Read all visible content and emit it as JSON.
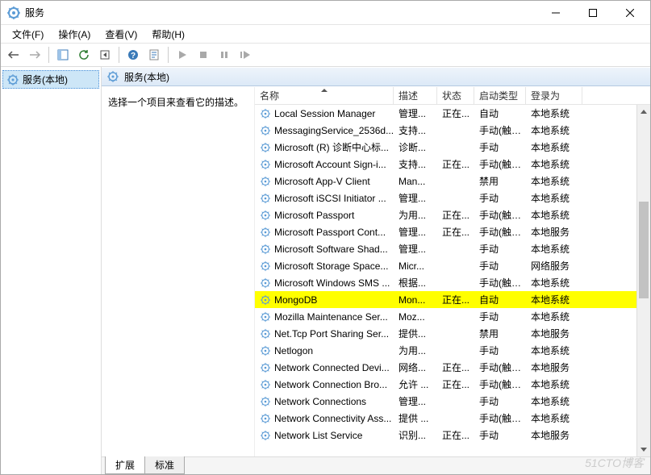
{
  "window": {
    "title": "服务"
  },
  "menu": {
    "file": "文件(F)",
    "action": "操作(A)",
    "view": "查看(V)",
    "help": "帮助(H)"
  },
  "tree": {
    "root": "服务(本地)"
  },
  "pane": {
    "header": "服务(本地)",
    "detail_prompt": "选择一个项目来查看它的描述。"
  },
  "columns": {
    "name": "名称",
    "description": "描述",
    "status": "状态",
    "startup_type": "启动类型",
    "log_on_as": "登录为"
  },
  "services": [
    {
      "name": "Local Session Manager",
      "desc": "管理...",
      "status": "正在...",
      "startup": "自动",
      "logon": "本地系统",
      "highlight": false
    },
    {
      "name": "MessagingService_2536d...",
      "desc": "支持...",
      "status": "",
      "startup": "手动(触发...",
      "logon": "本地系统",
      "highlight": false
    },
    {
      "name": "Microsoft (R) 诊断中心标...",
      "desc": "诊断...",
      "status": "",
      "startup": "手动",
      "logon": "本地系统",
      "highlight": false
    },
    {
      "name": "Microsoft Account Sign-i...",
      "desc": "支持...",
      "status": "正在...",
      "startup": "手动(触发...",
      "logon": "本地系统",
      "highlight": false
    },
    {
      "name": "Microsoft App-V Client",
      "desc": "Man...",
      "status": "",
      "startup": "禁用",
      "logon": "本地系统",
      "highlight": false
    },
    {
      "name": "Microsoft iSCSI Initiator ...",
      "desc": "管理...",
      "status": "",
      "startup": "手动",
      "logon": "本地系统",
      "highlight": false
    },
    {
      "name": "Microsoft Passport",
      "desc": "为用...",
      "status": "正在...",
      "startup": "手动(触发...",
      "logon": "本地系统",
      "highlight": false
    },
    {
      "name": "Microsoft Passport Cont...",
      "desc": "管理...",
      "status": "正在...",
      "startup": "手动(触发...",
      "logon": "本地服务",
      "highlight": false
    },
    {
      "name": "Microsoft Software Shad...",
      "desc": "管理...",
      "status": "",
      "startup": "手动",
      "logon": "本地系统",
      "highlight": false
    },
    {
      "name": "Microsoft Storage Space...",
      "desc": "Micr...",
      "status": "",
      "startup": "手动",
      "logon": "网络服务",
      "highlight": false
    },
    {
      "name": "Microsoft Windows SMS ...",
      "desc": "根据...",
      "status": "",
      "startup": "手动(触发...",
      "logon": "本地系统",
      "highlight": false
    },
    {
      "name": "MongoDB",
      "desc": "Mon...",
      "status": "正在...",
      "startup": "自动",
      "logon": "本地系统",
      "highlight": true
    },
    {
      "name": "Mozilla Maintenance Ser...",
      "desc": "Moz...",
      "status": "",
      "startup": "手动",
      "logon": "本地系统",
      "highlight": false
    },
    {
      "name": "Net.Tcp Port Sharing Ser...",
      "desc": "提供...",
      "status": "",
      "startup": "禁用",
      "logon": "本地服务",
      "highlight": false
    },
    {
      "name": "Netlogon",
      "desc": "为用...",
      "status": "",
      "startup": "手动",
      "logon": "本地系统",
      "highlight": false
    },
    {
      "name": "Network Connected Devi...",
      "desc": "网络...",
      "status": "正在...",
      "startup": "手动(触发...",
      "logon": "本地服务",
      "highlight": false
    },
    {
      "name": "Network Connection Bro...",
      "desc": "允许 ...",
      "status": "正在...",
      "startup": "手动(触发...",
      "logon": "本地系统",
      "highlight": false
    },
    {
      "name": "Network Connections",
      "desc": "管理...",
      "status": "",
      "startup": "手动",
      "logon": "本地系统",
      "highlight": false
    },
    {
      "name": "Network Connectivity Ass...",
      "desc": "提供 ...",
      "status": "",
      "startup": "手动(触发...",
      "logon": "本地系统",
      "highlight": false
    },
    {
      "name": "Network List Service",
      "desc": "识别...",
      "status": "正在...",
      "startup": "手动",
      "logon": "本地服务",
      "highlight": false
    }
  ],
  "tabs": {
    "extended": "扩展",
    "standard": "标准"
  },
  "watermark": "51CTO博客"
}
